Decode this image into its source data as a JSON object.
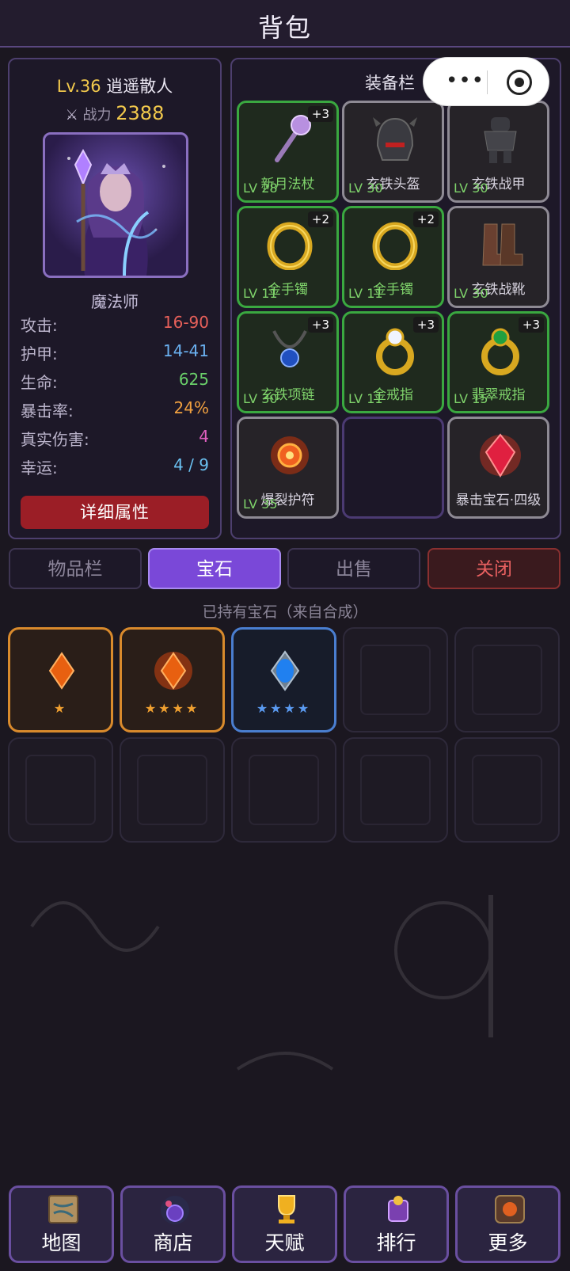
{
  "header": {
    "title": "背包"
  },
  "character": {
    "level": "Lv.36",
    "name": "逍遥散人",
    "power_label": "战力",
    "power_value": "2388",
    "class_name": "魔法师",
    "stats": [
      {
        "label": "攻击:",
        "value": "16-90",
        "color": "#e8605a"
      },
      {
        "label": "护甲:",
        "value": "14-41",
        "color": "#6ab0f0"
      },
      {
        "label": "生命:",
        "value": "625",
        "color": "#6ad06a"
      },
      {
        "label": "暴击率:",
        "value": "24%",
        "color": "#f0a040"
      },
      {
        "label": "真实伤害:",
        "value": "4",
        "color": "#e060c0"
      },
      {
        "label": "幸运:",
        "value": "4 / 9",
        "color": "#6ac0f0"
      }
    ],
    "detail_button": "详细属性"
  },
  "equipment": {
    "title": "装备栏",
    "slots": [
      {
        "name": "新月法杖",
        "level": "LV 28",
        "plus": "+3",
        "icon": "staff-icon"
      },
      {
        "name": "玄铁头盔",
        "level": "LV 30",
        "plus": "",
        "icon": "helmet-icon"
      },
      {
        "name": "玄铁战甲",
        "level": "LV 30",
        "plus": "",
        "icon": "armor-icon"
      },
      {
        "name": "金手镯",
        "level": "LV 11",
        "plus": "+2",
        "icon": "bracelet-icon"
      },
      {
        "name": "金手镯",
        "level": "LV 11",
        "plus": "+2",
        "icon": "bracelet-icon"
      },
      {
        "name": "玄铁战靴",
        "level": "LV 30",
        "plus": "",
        "icon": "boots-icon"
      },
      {
        "name": "玄铁项链",
        "level": "LV 30",
        "plus": "+3",
        "icon": "necklace-icon"
      },
      {
        "name": "金戒指",
        "level": "LV 11",
        "plus": "+3",
        "icon": "ring-icon"
      },
      {
        "name": "翡翠戒指",
        "level": "LV 15",
        "plus": "+3",
        "icon": "emerald-ring-icon"
      },
      {
        "name": "爆裂护符",
        "level": "LV 35",
        "plus": "",
        "icon": "amulet-icon"
      },
      {
        "name": "",
        "level": "",
        "plus": "",
        "icon": ""
      },
      {
        "name": "暴击宝石·四级",
        "level": "",
        "plus": "",
        "icon": "crit-gem-icon"
      }
    ]
  },
  "tabs": {
    "items": "物品栏",
    "gems": "宝石",
    "sell": "出售",
    "close": "关闭"
  },
  "gems_hint": "已持有宝石（来自合成）",
  "gems": [
    {
      "stars": "★",
      "rarity": "orange"
    },
    {
      "stars": "★★★★",
      "rarity": "orange"
    },
    {
      "stars": "★★★★",
      "rarity": "blue"
    }
  ],
  "nav": {
    "map": "地图",
    "shop": "商店",
    "talent": "天赋",
    "rank": "排行",
    "more": "更多"
  }
}
